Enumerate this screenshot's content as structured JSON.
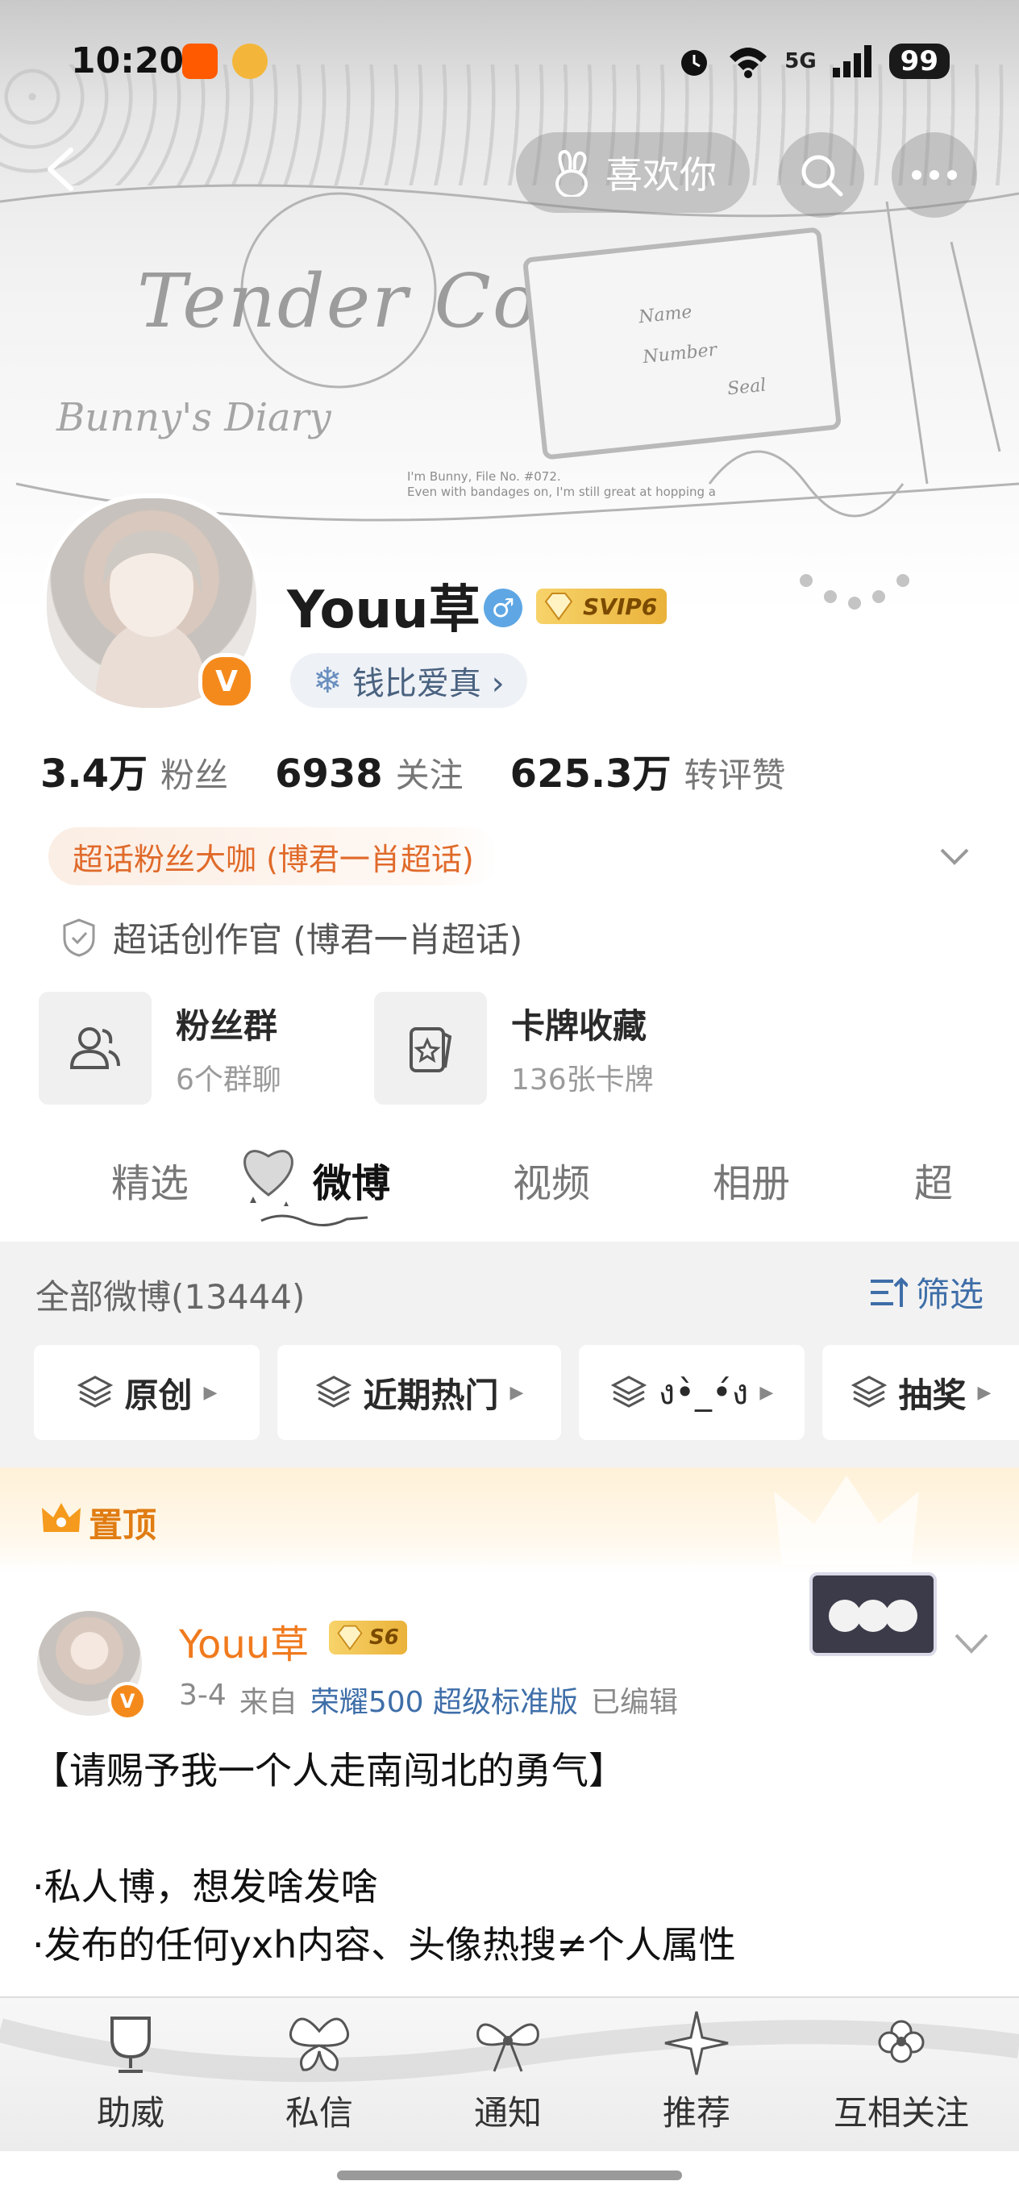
{
  "status_bar": {
    "time": "10:20",
    "network": "5G",
    "battery": "99"
  },
  "banner": {
    "title": "Tender Code",
    "subtitle": "Bunny's Diary",
    "small_line1": "I'm Bunny, File No. #072.",
    "small_line2": "Even with bandages on, I'm still great at hopping a",
    "ticket_name": "Name",
    "ticket_number": "Number",
    "ticket_seal": "Seal"
  },
  "nav": {
    "like_label": "喜欢你"
  },
  "profile": {
    "username": "Youu草",
    "gender_symbol": "♂",
    "vip_label": "SVIP6",
    "verified_mark": "V",
    "tag_label": "钱比爱真 ›",
    "stats": [
      {
        "num": "3.4万",
        "label": "粉丝"
      },
      {
        "num": "6938",
        "label": "关注"
      },
      {
        "num": "625.3万",
        "label": "转评赞"
      }
    ],
    "fan_badge": "超话粉丝大咖 (博君一肖超话)",
    "creator_badge": "超话创作官 (博君一肖超话)",
    "cards": [
      {
        "title": "粉丝群",
        "sub": "6个群聊"
      },
      {
        "title": "卡牌收藏",
        "sub": "136张卡牌"
      }
    ]
  },
  "tabs": [
    "精选",
    "微博",
    "视频",
    "相册",
    "超"
  ],
  "feed": {
    "count_label": "全部微博(13444)",
    "filter_label": "筛选",
    "chips": [
      "原创",
      "近期热门",
      "ง•̀_•́ง",
      "抽奖"
    ],
    "pinned_label": "置顶"
  },
  "post": {
    "author": "Youu草",
    "level_badge": "S6",
    "date": "3-4",
    "from": "来自",
    "source": "荣耀500 超级标准版",
    "edited": "已编辑",
    "lines": [
      "【请赐予我一个人走南闯北的勇气】",
      "",
      "·私人博，想发啥发啥",
      "·发布的任何yxh内容、头像热搜≠个人属性"
    ]
  },
  "bottom_bar": [
    "助威",
    "私信",
    "通知",
    "推荐",
    "互相关注"
  ],
  "colors": {
    "accent_orange": "#f07a1e",
    "link_blue": "#3e6ea8",
    "vip_gold": "#eab23a"
  }
}
